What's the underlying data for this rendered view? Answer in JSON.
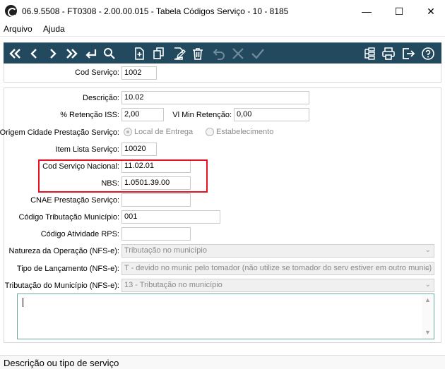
{
  "window": {
    "title": "06.9.5508 - FT0308 - 2.00.00.015 - Tabela Códigos Serviço - 10 - 8185",
    "minimize_glyph": "—",
    "maximize_glyph": "☐",
    "close_glyph": "✕"
  },
  "menu": {
    "items": [
      "Arquivo",
      "Ajuda"
    ]
  },
  "toolbar": {
    "background": "#23495f",
    "icons": [
      "first-record-icon",
      "previous-record-icon",
      "next-record-icon",
      "last-record-icon",
      "return-icon",
      "search-icon",
      "new-record-icon",
      "copy-record-icon",
      "edit-record-icon",
      "delete-record-icon",
      "undo-icon",
      "cancel-icon",
      "confirm-icon",
      "tree-structure-icon",
      "print-icon",
      "exit-icon",
      "help-icon"
    ]
  },
  "form": {
    "cod_servico": {
      "label": "Cod Serviço:",
      "value": "1002"
    },
    "descricao": {
      "label": "Descrição:",
      "value": "10.02"
    },
    "retencao_iss": {
      "label": "% Retenção ISS:",
      "value": "2,00"
    },
    "vl_min_retencao": {
      "label": "Vl Min Retenção:",
      "value": "0,00"
    },
    "origem_cidade": {
      "label": "Origem Cidade Prestação Serviço:",
      "options": [
        "Local de Entrega",
        "Estabelecimento"
      ],
      "selected": "Local de Entrega"
    },
    "item_lista": {
      "label": "Item Lista Serviço:",
      "value": "10020"
    },
    "cod_servico_nacional": {
      "label": "Cod Serviço Nacional:",
      "value": "11.02.01"
    },
    "nbs": {
      "label": "NBS:",
      "value": "1.0501.39.00"
    },
    "cnae": {
      "label": "CNAE Prestação Serviço:",
      "value": ""
    },
    "codigo_tributacao_municipio": {
      "label": "Código Tributação Município:",
      "value": "001"
    },
    "codigo_atividade_rps": {
      "label": "Código Atividade RPS:",
      "value": ""
    },
    "natureza_operacao": {
      "label": "Natureza da Operação (NFS-e):",
      "value": "Tributação no município"
    },
    "tipo_lancamento": {
      "label": "Tipo de Lançamento (NFS-e):",
      "value": "T - devido no munic pelo tomador (não utilize se tomador do serv estiver em outro munic)"
    },
    "tributacao_municipio": {
      "label": "Tributação do Município (NFS-e):",
      "value": "13 - Tributação no município"
    }
  },
  "highlight_color": "#e81123",
  "status": {
    "text": "Descrição ou tipo de serviço"
  }
}
